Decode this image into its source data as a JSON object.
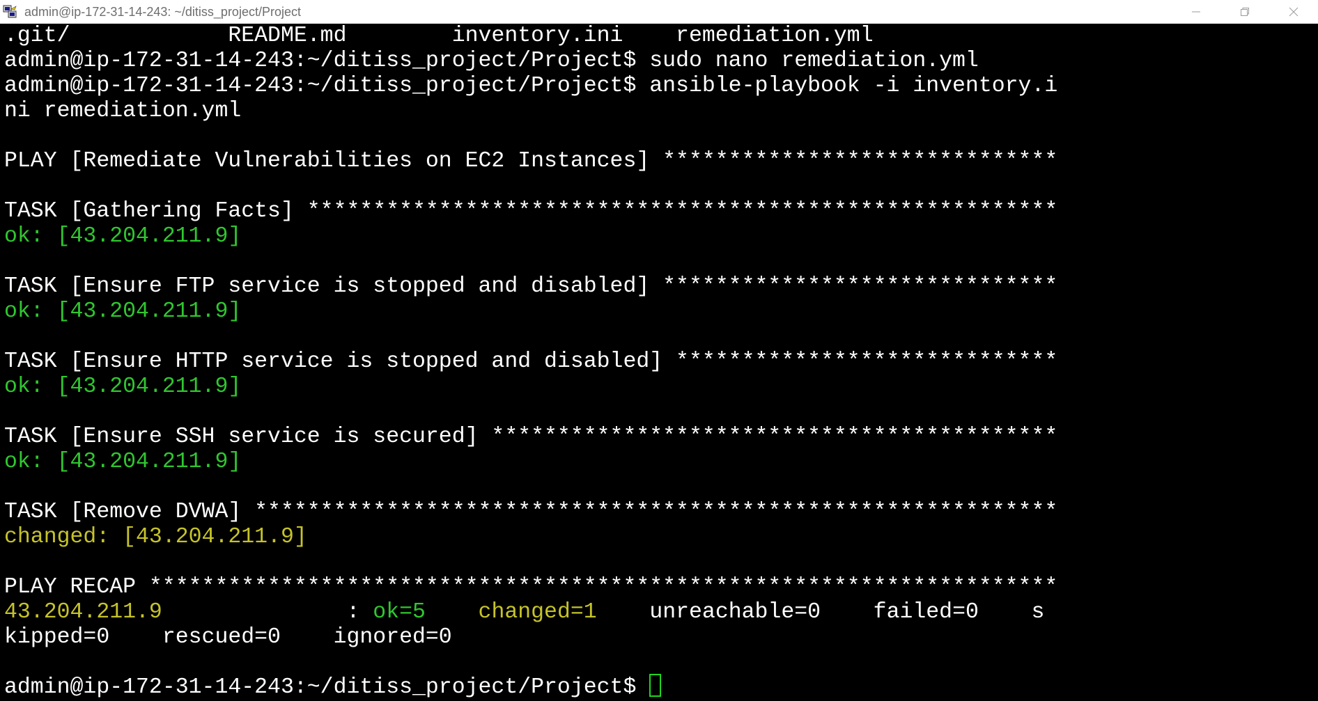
{
  "window": {
    "title": "admin@ip-172-31-14-243: ~/ditiss_project/Project",
    "app_icon": "putty-icon",
    "controls": [
      "minimize-icon",
      "restore-icon",
      "close-icon"
    ]
  },
  "colors": {
    "background": "#000000",
    "text": "#ffffff",
    "ok": "#2fc72f",
    "changed": "#c6c32a",
    "cursor": "#1ed71e"
  },
  "terminal": {
    "ls_output": ".git/            README.md        inventory.ini    remediation.yml",
    "prompt": "admin@ip-172-31-14-243:~/ditiss_project/Project$",
    "cmd1": " sudo nano remediation.yml",
    "cmd2": " ansible-playbook -i inventory.i",
    "cmd2_wrap": "ni remediation.yml",
    "play": "PLAY [Remediate Vulnerabilities on EC2 Instances] ******************************",
    "tasks": [
      {
        "header": "TASK [Gathering Facts] *********************************************************",
        "result": "ok: [43.204.211.9]"
      },
      {
        "header": "TASK [Ensure FTP service is stopped and disabled] ******************************",
        "result": "ok: [43.204.211.9]"
      },
      {
        "header": "TASK [Ensure HTTP service is stopped and disabled] *****************************",
        "result": "ok: [43.204.211.9]"
      },
      {
        "header": "TASK [Ensure SSH service is secured] *******************************************",
        "result": "ok: [43.204.211.9]"
      },
      {
        "header": "TASK [Remove DVWA] *************************************************************",
        "result": "changed: [43.204.211.9]"
      }
    ],
    "recap_header": "PLAY RECAP *********************************************************************",
    "recap": {
      "host": "43.204.211.9",
      "sep": "              : ",
      "ok": "ok=5",
      "gap1": "    ",
      "changed": "changed=1",
      "gap2": "    ",
      "rest": "unreachable=0    failed=0    s",
      "wrap": "kipped=0    rescued=0    ignored=0"
    }
  }
}
